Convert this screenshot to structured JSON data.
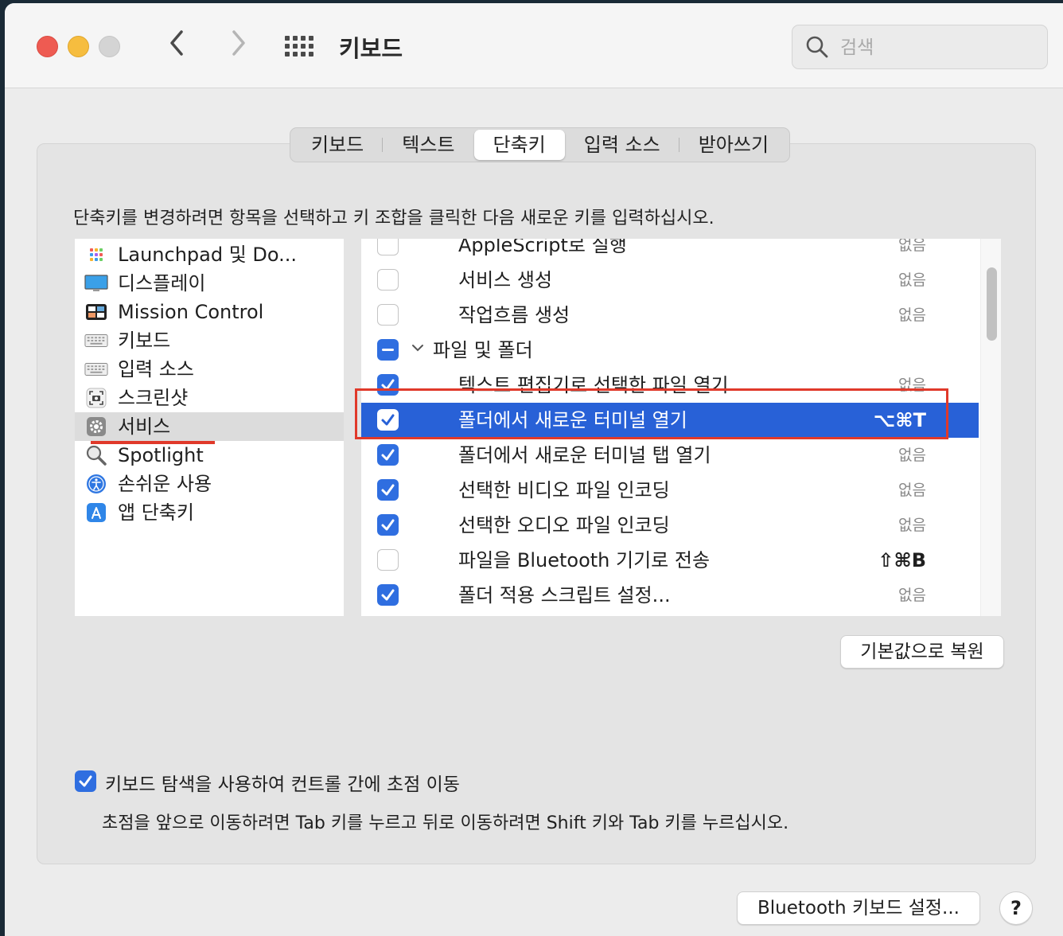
{
  "window": {
    "title": "키보드",
    "search_placeholder": "검색",
    "nav_back": "‹",
    "nav_forward": "›"
  },
  "tabs": [
    {
      "label": "키보드",
      "active": false
    },
    {
      "label": "텍스트",
      "active": false
    },
    {
      "label": "단축키",
      "active": true
    },
    {
      "label": "입력 소스",
      "active": false
    },
    {
      "label": "받아쓰기",
      "active": false
    }
  ],
  "instruction": "단축키를 변경하려면 항목을 선택하고 키 조합을 클릭한 다음 새로운 키를 입력하십시오.",
  "categories": [
    {
      "label": "Launchpad 및 Do...",
      "icon": "launchpad-icon",
      "selected": false
    },
    {
      "label": "디스플레이",
      "icon": "display-icon",
      "selected": false
    },
    {
      "label": "Mission Control",
      "icon": "mission-control-icon",
      "selected": false
    },
    {
      "label": "키보드",
      "icon": "keyboard-icon",
      "selected": false
    },
    {
      "label": "입력 소스",
      "icon": "input-source-icon",
      "selected": false
    },
    {
      "label": "스크린샷",
      "icon": "screenshot-icon",
      "selected": false
    },
    {
      "label": "서비스",
      "icon": "gear-icon",
      "selected": true
    },
    {
      "label": "Spotlight",
      "icon": "spotlight-icon",
      "selected": false
    },
    {
      "label": "손쉬운 사용",
      "icon": "accessibility-icon",
      "selected": false
    },
    {
      "label": "앱 단축키",
      "icon": "app-shortcuts-icon",
      "selected": false
    }
  ],
  "services": [
    {
      "label": "AppleScript로 실행",
      "shortcut": "없음",
      "state": "unchecked",
      "group": false
    },
    {
      "label": "서비스 생성",
      "shortcut": "없음",
      "state": "unchecked",
      "group": false
    },
    {
      "label": "작업흐름 생성",
      "shortcut": "없음",
      "state": "unchecked",
      "group": false
    },
    {
      "label": "파일 및 폴더",
      "shortcut": "",
      "state": "mixed",
      "group": true
    },
    {
      "label": "텍스트 편집기로 선택한 파일 열기",
      "shortcut": "없음",
      "state": "checked",
      "group": false
    },
    {
      "label": "폴더에서 새로운 터미널 열기",
      "shortcut": "⌥⌘T",
      "state": "checked",
      "group": false,
      "selected": true
    },
    {
      "label": "폴더에서 새로운 터미널 탭 열기",
      "shortcut": "없음",
      "state": "checked",
      "group": false
    },
    {
      "label": "선택한 비디오 파일 인코딩",
      "shortcut": "없음",
      "state": "checked",
      "group": false
    },
    {
      "label": "선택한 오디오 파일 인코딩",
      "shortcut": "없음",
      "state": "checked",
      "group": false
    },
    {
      "label": "파일을 Bluetooth 기기로 전송",
      "shortcut": "⇧⌘B",
      "state": "unchecked",
      "group": false
    },
    {
      "label": "폴더 적용 스크립트 설정...",
      "shortcut": "없음",
      "state": "checked",
      "group": false
    }
  ],
  "buttons": {
    "restore_defaults": "기본값으로 복원",
    "bluetooth_keyboard": "Bluetooth 키보드 설정...",
    "help": "?"
  },
  "keyboard_navigation": {
    "label": "키보드 탐색을 사용하여 컨트롤 간에 초점 이동",
    "checked": true,
    "description": "초점을 앞으로 이동하려면 Tab 키를 누르고 뒤로 이동하려면 Shift 키와 Tab 키를 누르십시오."
  },
  "colors": {
    "accent": "#2f6ee0",
    "selection": "#2861d7",
    "annotation_red": "#e0392a"
  }
}
